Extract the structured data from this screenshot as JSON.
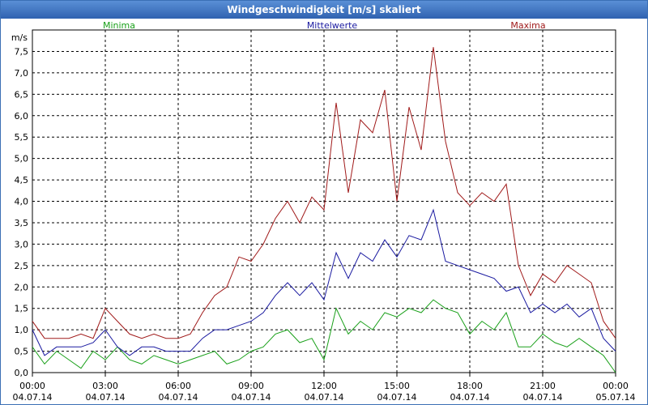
{
  "window": {
    "title": "Windgeschwindigkeit [m/s] skaliert"
  },
  "chart_data": {
    "type": "line",
    "title": "Windgeschwindigkeit [m/s] skaliert",
    "ylabel": "m/s",
    "ylim": [
      0,
      8
    ],
    "y_ticks": [
      "0,0",
      "0,5",
      "1,0",
      "1,5",
      "2,0",
      "2,5",
      "3,0",
      "3,5",
      "4,0",
      "4,5",
      "5,0",
      "5,5",
      "6,0",
      "6,5",
      "7,0",
      "7,5"
    ],
    "x_ticks": [
      {
        "time": "00:00",
        "date": "04.07.14"
      },
      {
        "time": "03:00",
        "date": "04.07.14"
      },
      {
        "time": "06:00",
        "date": "04.07.14"
      },
      {
        "time": "09:00",
        "date": "04.07.14"
      },
      {
        "time": "12:00",
        "date": "04.07.14"
      },
      {
        "time": "15:00",
        "date": "04.07.14"
      },
      {
        "time": "18:00",
        "date": "04.07.14"
      },
      {
        "time": "21:00",
        "date": "04.07.14"
      },
      {
        "time": "00:00",
        "date": "05.07.14"
      }
    ],
    "x_unit": "hours",
    "xlim": [
      0,
      24
    ],
    "grid": true,
    "legend_position": "top",
    "series": [
      {
        "name": "Minima",
        "color": "#1aa01a",
        "x": [
          0,
          0.5,
          1,
          1.5,
          2,
          2.5,
          3,
          3.5,
          4,
          4.5,
          5,
          5.5,
          6,
          6.5,
          7,
          7.5,
          8,
          8.5,
          9,
          9.5,
          10,
          10.5,
          11,
          11.5,
          12,
          12.5,
          13,
          13.5,
          14,
          14.5,
          15,
          15.5,
          16,
          16.5,
          17,
          17.5,
          18,
          18.5,
          19,
          19.5,
          20,
          20.5,
          21,
          21.5,
          22,
          22.5,
          23,
          23.5,
          24
        ],
        "values": [
          0.6,
          0.2,
          0.5,
          0.3,
          0.1,
          0.5,
          0.3,
          0.6,
          0.3,
          0.2,
          0.4,
          0.3,
          0.2,
          0.3,
          0.4,
          0.5,
          0.2,
          0.3,
          0.5,
          0.6,
          0.9,
          1.0,
          0.7,
          0.8,
          0.3,
          1.5,
          0.9,
          1.2,
          1.0,
          1.4,
          1.3,
          1.5,
          1.4,
          1.7,
          1.5,
          1.4,
          0.9,
          1.2,
          1.0,
          1.4,
          0.6,
          0.6,
          0.9,
          0.7,
          0.6,
          0.8,
          0.6,
          0.4,
          0.0
        ]
      },
      {
        "name": "Mittelwerte",
        "color": "#1a1aa0",
        "x": [
          0,
          0.5,
          1,
          1.5,
          2,
          2.5,
          3,
          3.5,
          4,
          4.5,
          5,
          5.5,
          6,
          6.5,
          7,
          7.5,
          8,
          8.5,
          9,
          9.5,
          10,
          10.5,
          11,
          11.5,
          12,
          12.5,
          13,
          13.5,
          14,
          14.5,
          15,
          15.5,
          16,
          16.5,
          17,
          17.5,
          18,
          18.5,
          19,
          19.5,
          20,
          20.5,
          21,
          21.5,
          22,
          22.5,
          23,
          23.5,
          24
        ],
        "values": [
          1.0,
          0.4,
          0.6,
          0.6,
          0.6,
          0.7,
          1.0,
          0.6,
          0.4,
          0.6,
          0.6,
          0.5,
          0.5,
          0.5,
          0.8,
          1.0,
          1.0,
          1.1,
          1.2,
          1.4,
          1.8,
          2.1,
          1.8,
          2.1,
          1.7,
          2.8,
          2.2,
          2.8,
          2.6,
          3.1,
          2.7,
          3.2,
          3.1,
          3.8,
          2.6,
          2.5,
          2.4,
          2.3,
          2.2,
          1.9,
          2.0,
          1.4,
          1.6,
          1.4,
          1.6,
          1.3,
          1.5,
          0.8,
          0.5
        ]
      },
      {
        "name": "Maxima",
        "color": "#a01a1a",
        "x": [
          0,
          0.5,
          1,
          1.5,
          2,
          2.5,
          3,
          3.5,
          4,
          4.5,
          5,
          5.5,
          6,
          6.5,
          7,
          7.5,
          8,
          8.5,
          9,
          9.5,
          10,
          10.5,
          11,
          11.5,
          12,
          12.5,
          13,
          13.5,
          14,
          14.5,
          15,
          15.5,
          16,
          16.5,
          17,
          17.5,
          18,
          18.5,
          19,
          19.5,
          20,
          20.5,
          21,
          21.5,
          22,
          22.5,
          23,
          23.5,
          24
        ],
        "values": [
          1.2,
          0.8,
          0.8,
          0.8,
          0.9,
          0.8,
          1.5,
          1.2,
          0.9,
          0.8,
          0.9,
          0.8,
          0.8,
          0.9,
          1.4,
          1.8,
          2.0,
          2.7,
          2.6,
          3.0,
          3.6,
          4.0,
          3.5,
          4.1,
          3.8,
          6.3,
          4.2,
          5.9,
          5.6,
          6.6,
          4.0,
          6.2,
          5.2,
          7.6,
          5.4,
          4.2,
          3.9,
          4.2,
          4.0,
          4.4,
          2.5,
          1.8,
          2.3,
          2.1,
          2.5,
          2.3,
          2.1,
          1.2,
          0.8
        ]
      }
    ]
  }
}
